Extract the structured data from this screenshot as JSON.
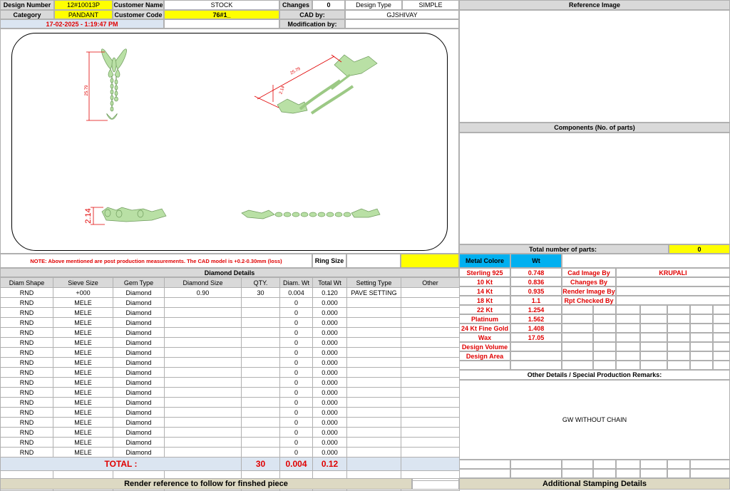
{
  "header": {
    "design_number_label": "Design Number",
    "design_number": "12#10013P",
    "customer_name_label": "Customer Name",
    "customer_name": "STOCK",
    "changes_label": "Changes",
    "changes": "0",
    "design_type_label": "Design Type",
    "design_type": "SIMPLE",
    "category_label": "Category",
    "category": "PANDANT",
    "customer_code_label": "Customer Code",
    "customer_code": "76#1_",
    "cad_by_label": "CAD by:",
    "cad_by": "GJSHIVAY",
    "date": "17-02-2025 - 1:19:47 PM",
    "modification_label": "Modification by:",
    "modification": ""
  },
  "drawing": {
    "dim_length_1": "25.79",
    "dim_length_2": "25.79",
    "dim_height_1": "2.14",
    "dim_height_2": "2.14"
  },
  "right_panel": {
    "reference_image_label": "Reference Image",
    "components_label": "Components (No. of parts)",
    "total_parts_label": "Total number of parts:",
    "total_parts": "0"
  },
  "note": {
    "text": "NOTE: Above mentioned are post production measurements. The CAD model is +0.2-0.30mm (loss)",
    "ring_size_label": "Ring Size",
    "ring_size": ""
  },
  "diamond": {
    "title": "Diamond Details",
    "columns": [
      "Diam Shape",
      "Sieve Size",
      "Gem Type",
      "Diamond Size",
      "QTY.",
      "Diam. Wt",
      "Total Wt",
      "Setting Type",
      "Other"
    ],
    "rows": [
      [
        "RND",
        "+000",
        "Diamond",
        "0.90",
        "30",
        "0.004",
        "0.120",
        "PAVE SETTING",
        ""
      ],
      [
        "RND",
        "MELE",
        "Diamond",
        "",
        "",
        "0",
        "0.000",
        "",
        ""
      ],
      [
        "RND",
        "MELE",
        "Diamond",
        "",
        "",
        "0",
        "0.000",
        "",
        ""
      ],
      [
        "RND",
        "MELE",
        "Diamond",
        "",
        "",
        "0",
        "0.000",
        "",
        ""
      ],
      [
        "RND",
        "MELE",
        "Diamond",
        "",
        "",
        "0",
        "0.000",
        "",
        ""
      ],
      [
        "RND",
        "MELE",
        "Diamond",
        "",
        "",
        "0",
        "0.000",
        "",
        ""
      ],
      [
        "RND",
        "MELE",
        "Diamond",
        "",
        "",
        "0",
        "0.000",
        "",
        ""
      ],
      [
        "RND",
        "MELE",
        "Diamond",
        "",
        "",
        "0",
        "0.000",
        "",
        ""
      ],
      [
        "RND",
        "MELE",
        "Diamond",
        "",
        "",
        "0",
        "0.000",
        "",
        ""
      ],
      [
        "RND",
        "MELE",
        "Diamond",
        "",
        "",
        "0",
        "0.000",
        "",
        ""
      ],
      [
        "RND",
        "MELE",
        "Diamond",
        "",
        "",
        "0",
        "0.000",
        "",
        ""
      ],
      [
        "RND",
        "MELE",
        "Diamond",
        "",
        "",
        "0",
        "0.000",
        "",
        ""
      ],
      [
        "RND",
        "MELE",
        "Diamond",
        "",
        "",
        "0",
        "0.000",
        "",
        ""
      ],
      [
        "RND",
        "MELE",
        "Diamond",
        "",
        "",
        "0",
        "0.000",
        "",
        ""
      ],
      [
        "RND",
        "MELE",
        "Diamond",
        "",
        "",
        "0",
        "0.000",
        "",
        ""
      ],
      [
        "RND",
        "MELE",
        "Diamond",
        "",
        "",
        "0",
        "0.000",
        "",
        ""
      ],
      [
        "RND",
        "MELE",
        "Diamond",
        "",
        "",
        "0",
        "0.000",
        "",
        ""
      ]
    ],
    "total_label": "TOTAL :",
    "total_qty": "30",
    "total_diam_wt": "0.004",
    "total_wt": "0.12"
  },
  "metal": {
    "color_label": "Metal Colore",
    "wt_label": "Wt",
    "rows": [
      {
        "name": "Sterling 925",
        "wt": "0.748"
      },
      {
        "name": "10 Kt",
        "wt": "0.836"
      },
      {
        "name": "14 Kt",
        "wt": "0.935"
      },
      {
        "name": "18 Kt",
        "wt": "1.1"
      },
      {
        "name": "22 Kt",
        "wt": "1.254"
      },
      {
        "name": "Platinum",
        "wt": "1.562"
      },
      {
        "name": "24 Kt Fine Gold",
        "wt": "1.408"
      },
      {
        "name": "Wax",
        "wt": "17.05"
      },
      {
        "name": "Design Volume",
        "wt": ""
      },
      {
        "name": "Design Area",
        "wt": ""
      }
    ]
  },
  "credits": {
    "cad_image_by_label": "Cad Image By",
    "cad_image_by": "KRUPALI",
    "changes_by_label": "Changes By",
    "render_image_by_label": "Render Image By",
    "rpt_checked_by_label": "Rpt Checked By"
  },
  "remarks": {
    "title": "Other Details / Special Production Remarks:",
    "text": "GW WITHOUT CHAIN"
  },
  "footer": {
    "render_reference": "Render reference to follow for finshed piece",
    "stamping": "Additional Stamping Details"
  },
  "colors": {
    "yellow": "#ffff00",
    "light_blue": "#dbe5f1",
    "red": "#e00000",
    "cyan": "#00b0f0",
    "model_green": "#b9e0a5"
  }
}
